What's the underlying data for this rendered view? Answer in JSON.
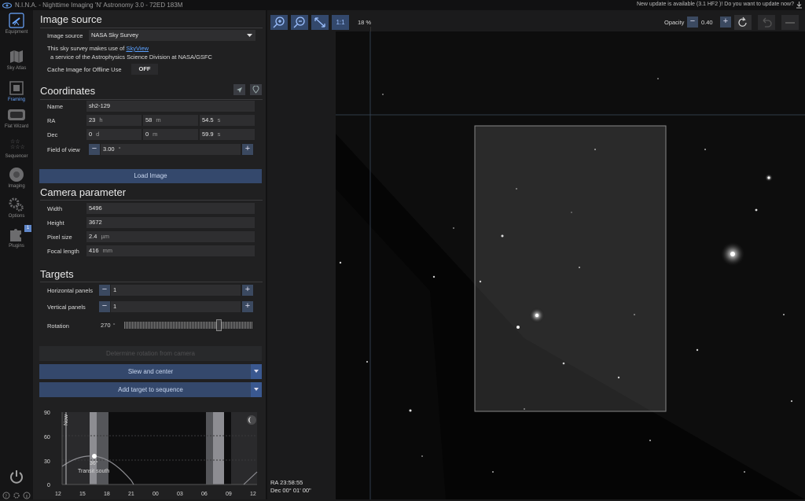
{
  "titlebar": {
    "title": "N.I.N.A. - Nighttime Imaging 'N' Astronomy 3.0   -  72ED 183M",
    "update_text": "New update is available (3.1 HF2 )! Do you want to update now?"
  },
  "sidebar": {
    "items": [
      {
        "label": "Equipment",
        "icon": "telescope-icon"
      },
      {
        "label": "Sky Atlas",
        "icon": "map-icon"
      },
      {
        "label": "Framing",
        "icon": "framing-icon"
      },
      {
        "label": "Flat Wizard",
        "icon": "flat-panel-icon"
      },
      {
        "label": "Sequencer",
        "icon": "stars-icon"
      },
      {
        "label": "Imaging",
        "icon": "imaging-icon"
      },
      {
        "label": "Options",
        "icon": "gears-icon"
      },
      {
        "label": "Plugins",
        "icon": "puzzle-icon"
      }
    ],
    "plugins_badge": "1",
    "active": "Framing"
  },
  "image_source": {
    "heading": "Image source",
    "label": "Image source",
    "value": "NASA Sky Survey",
    "note_prefix": "This sky survey makes use of ",
    "note_link": "SkyView",
    "note_line2": "a service of the Astrophysics Science Division at NASA/GSFC",
    "cache_label": "Cache Image for Offline Use",
    "cache_value": "OFF"
  },
  "coordinates": {
    "heading": "Coordinates",
    "name_label": "Name",
    "name_value": "sh2-129",
    "ra_label": "RA",
    "ra_h": "23",
    "ra_h_unit": "h",
    "ra_m": "58",
    "ra_m_unit": "m",
    "ra_s": "54.5",
    "ra_s_unit": "s",
    "dec_label": "Dec",
    "dec_d": "0",
    "dec_d_unit": "d",
    "dec_m": "0",
    "dec_m_unit": "m",
    "dec_s": "59.9",
    "dec_s_unit": "s",
    "fov_label": "Field of view",
    "fov_value": "3.00",
    "fov_unit": "°",
    "load_button": "Load Image"
  },
  "camera": {
    "heading": "Camera parameter",
    "width_label": "Width",
    "width_value": "5496",
    "height_label": "Height",
    "height_value": "3672",
    "pixel_label": "Pixel size",
    "pixel_value": "2.4",
    "pixel_unit": "µm",
    "focal_label": "Focal length",
    "focal_value": "416",
    "focal_unit": "mm"
  },
  "targets": {
    "heading": "Targets",
    "hpanels_label": "Horizontal panels",
    "hpanels_value": "1",
    "vpanels_label": "Vertical panels",
    "vpanels_value": "1",
    "rotation_label": "Rotation",
    "rotation_value": "270",
    "rotation_unit": "°",
    "rotation_fraction": 0.75,
    "determine_button": "Determine rotation from camera",
    "slew_button": "Slew and center",
    "add_button": "Add target to sequence"
  },
  "altitude_chart": {
    "y_ticks": [
      "90",
      "60",
      "30",
      "0"
    ],
    "x_ticks": [
      "12",
      "15",
      "18",
      "21",
      "00",
      "03",
      "06",
      "09",
      "12"
    ],
    "now_label": "Now",
    "transit_value": "36°",
    "transit_label": "Transit south"
  },
  "viewer": {
    "zoom_label": "18 %",
    "one_to_one": "1:1",
    "opacity_label": "Opacity",
    "opacity_value": "0.40",
    "ra_readout": "RA  23:58:55",
    "dec_readout": "Dec  00° 01' 00\""
  }
}
